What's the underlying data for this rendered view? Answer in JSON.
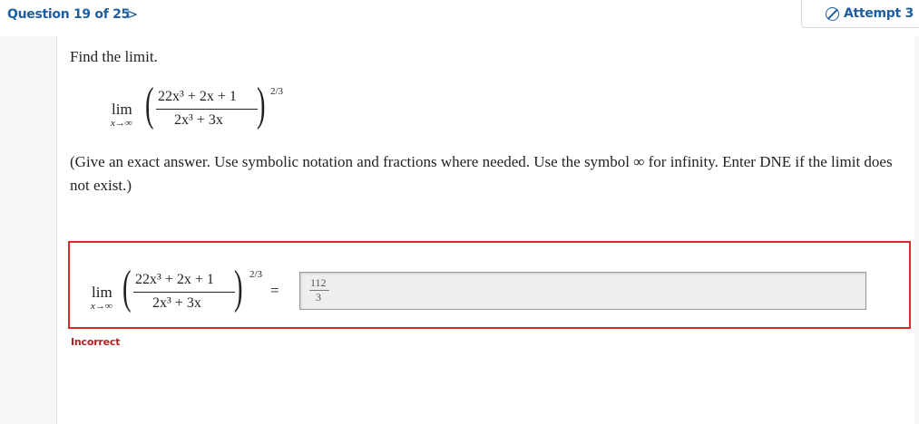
{
  "header": {
    "question_counter": "Question 19 of 25",
    "next_symbol": ">",
    "attempt_label": "Attempt 3"
  },
  "question": {
    "prompt": "Find the limit.",
    "instructions": "(Give an exact answer. Use symbolic notation and fractions where needed. Use the symbol ∞ for infinity. Enter DNE if the limit does not exist.)"
  },
  "expression": {
    "lim": "lim",
    "subscript": "x→∞",
    "numerator": "22x³ + 2x + 1",
    "denominator": "2x³ + 3x",
    "exponent": "2/3",
    "equals": "="
  },
  "answer": {
    "numerator": "112",
    "denominator": "3",
    "status": "Incorrect"
  },
  "colors": {
    "accent": "#1f5fa0",
    "error": "#d62b2b"
  }
}
